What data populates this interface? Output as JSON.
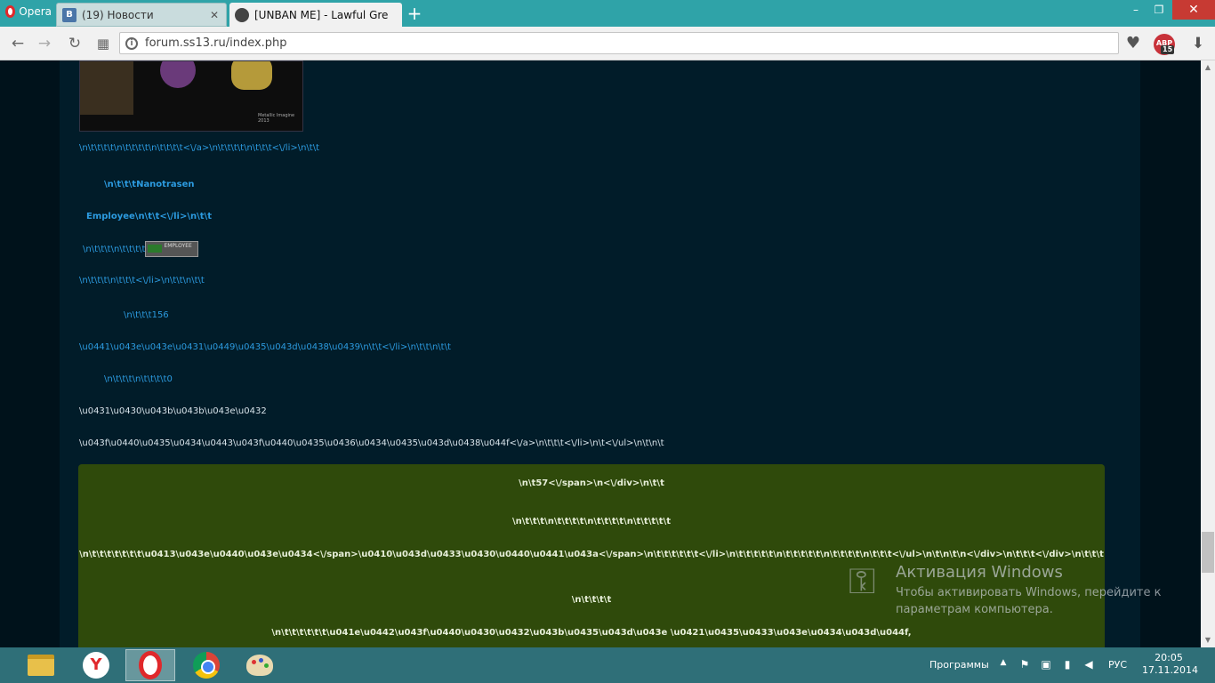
{
  "browser": {
    "menu_label": "Opera",
    "tabs": [
      {
        "label": "(19) Новости",
        "favicon": "В"
      },
      {
        "label": "[UNBAN ME] - Lawful Gre",
        "favicon": ""
      }
    ],
    "new_tab": "+",
    "window_controls": {
      "minimize": "–",
      "maximize": "❐",
      "close": "✕"
    },
    "address": "forum.ss13.ru/index.php",
    "abp": {
      "label": "ABP",
      "count": "15"
    }
  },
  "page": {
    "avatar_caption": "Metallic Imagine 2013",
    "lines": [
      "\\n\\t\\t\\t\\t\\n\\t\\t\\t\\t\\n\\t\\t\\t\\t<\\/a>\\n\\t\\t\\t\\t\\n\\t\\t\\t<\\/li>\\n\\t\\t",
      "\\n\\t\\t\\tNanotrasen",
      "Employee\\n\\t\\t<\\/li>\\n\\t\\t",
      "\\n\\t\\t\\t\\n\\t\\t\\t\\t",
      "\\n\\t\\t\\t\\n\\t\\t\\t<\\/li>\\n\\t\\t\\n\\t\\t",
      "\\n\\t\\t\\t156",
      "\\u0441\\u043e\\u043e\\u0431\\u0449\\u0435\\u043d\\u0438\\u0439\\n\\t\\t<\\/li>\\n\\t\\t\\n\\t\\t",
      "\\n\\t\\t\\t\\n\\t\\t\\t\\t0",
      "\\u0431\\u0430\\u043b\\u043b\\u043e\\u0432",
      "\\u043f\\u0440\\u0435\\u0434\\u0443\\u043f\\u0440\\u0435\\u0436\\u0434\\u0435\\u043d\\u0438\\u044f<\\/a>\\n\\t\\t\\t<\\/li>\\n\\t<\\/ul>\\n\\t\\n\\t"
    ],
    "employee_badge": "EMPLOYEE",
    "green_lines": [
      "\\n\\t57<\\/span>\\n<\\/div>\\n\\t\\t",
      "\\n\\t\\t\\t\\n\\t\\t\\t\\t\\n\\t\\t\\t\\t\\n\\t\\t\\t\\t\\t",
      "\\n\\t\\t\\t\\t\\t\\t\\t\\u0413\\u043e\\u0440\\u043e\\u0434<\\/span>\\u0410\\u043d\\u0433\\u0430\\u0440\\u0441\\u043a<\\/span>\\n\\t\\t\\t\\t\\t\\t<\\/li>\\n\\t\\t\\t\\t\\t\\n\\t\\t\\t\\t\\t\\n\\t\\t\\t\\t\\n\\t\\t\\t<\\/ul>\\n\\t\\n\\t\\n<\\/div>\\n\\t\\t\\t<\\/div>\\n\\t\\t\\t",
      "\\n\\t\\t\\t\\t",
      "\\n\\t\\t\\t\\t\\t\\t\\u041e\\u0442\\u043f\\u0440\\u0430\\u0432\\u043b\\u0435\\u043d\\u043e \\u0421\\u0435\\u0433\\u043e\\u0434\\u043d\\u044f,"
    ]
  },
  "watermark": {
    "title": "Активация Windows",
    "line1": "Чтобы активировать Windows, перейдите к",
    "line2": "параметрам компьютера."
  },
  "taskbar": {
    "programs_label": "Программы",
    "language": "РУС",
    "time": "20:05",
    "date": "17.11.2014"
  }
}
